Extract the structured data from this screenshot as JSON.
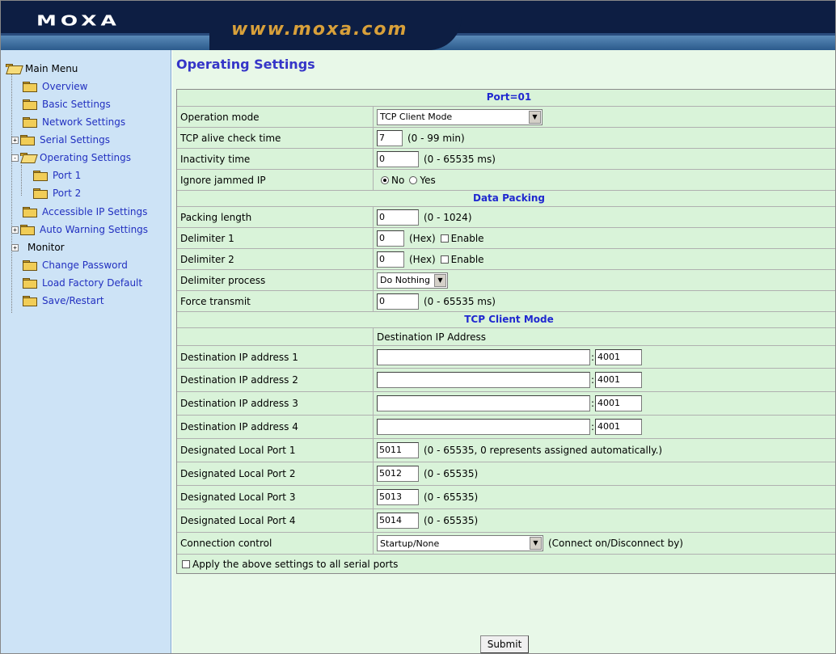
{
  "header": {
    "logo": "MOXA",
    "url": "www.moxa.com",
    "colors": {
      "navy": "#0d1e43",
      "url_orange": "#d8a03a"
    }
  },
  "sidebar": {
    "root_label": "Main Menu",
    "items": [
      {
        "label": "Overview"
      },
      {
        "label": "Basic Settings"
      },
      {
        "label": "Network Settings"
      },
      {
        "label": "Serial Settings",
        "expander": "+"
      },
      {
        "label": "Operating Settings",
        "expander": "-"
      },
      {
        "label": "Port 1"
      },
      {
        "label": "Port 2"
      },
      {
        "label": "Accessible IP Settings"
      },
      {
        "label": "Auto Warning Settings",
        "expander": "+"
      },
      {
        "label": "Monitor",
        "expander": "+"
      },
      {
        "label": "Change Password"
      },
      {
        "label": "Load Factory Default"
      },
      {
        "label": "Save/Restart"
      }
    ]
  },
  "main": {
    "title": "Operating Settings",
    "port_header": "Port=01",
    "operation_mode": {
      "label": "Operation mode",
      "value": "TCP Client Mode"
    },
    "tcp_alive": {
      "label": "TCP alive check time",
      "value": "7",
      "hint": "(0 - 99 min)"
    },
    "inactivity": {
      "label": "Inactivity time",
      "value": "0",
      "hint": "(0 - 65535 ms)"
    },
    "ignore_jammed": {
      "label": "Ignore jammed IP",
      "opt_no": "No",
      "opt_yes": "Yes",
      "selected": "No"
    },
    "data_packing_header": "Data Packing",
    "packing_length": {
      "label": "Packing length",
      "value": "0",
      "hint": "(0 - 1024)"
    },
    "delimiter1": {
      "label": "Delimiter 1",
      "value": "0",
      "hex": "(Hex)",
      "enable": "Enable"
    },
    "delimiter2": {
      "label": "Delimiter 2",
      "value": "0",
      "hex": "(Hex)",
      "enable": "Enable"
    },
    "delimiter_process": {
      "label": "Delimiter process",
      "value": "Do Nothing"
    },
    "force_transmit": {
      "label": "Force transmit",
      "value": "0",
      "hint": "(0 - 65535 ms)"
    },
    "tcp_client_header": "TCP Client Mode",
    "dest_col_header": "Destination IP Address",
    "destinations": [
      {
        "label": "Destination IP address 1",
        "ip": "",
        "port": "4001"
      },
      {
        "label": "Destination IP address 2",
        "ip": "",
        "port": "4001"
      },
      {
        "label": "Destination IP address 3",
        "ip": "",
        "port": "4001"
      },
      {
        "label": "Destination IP address 4",
        "ip": "",
        "port": "4001"
      }
    ],
    "local_ports": [
      {
        "label": "Designated Local Port 1",
        "value": "5011",
        "hint": "(0 - 65535, 0 represents assigned automatically.)"
      },
      {
        "label": "Designated Local Port 2",
        "value": "5012",
        "hint": "(0 - 65535)"
      },
      {
        "label": "Designated Local Port 3",
        "value": "5013",
        "hint": "(0 - 65535)"
      },
      {
        "label": "Designated Local Port 4",
        "value": "5014",
        "hint": "(0 - 65535)"
      }
    ],
    "connection_control": {
      "label": "Connection control",
      "value": "Startup/None",
      "hint": "(Connect on/Disconnect by)"
    },
    "apply_all": "Apply the above settings to all serial ports",
    "submit": "Submit"
  }
}
